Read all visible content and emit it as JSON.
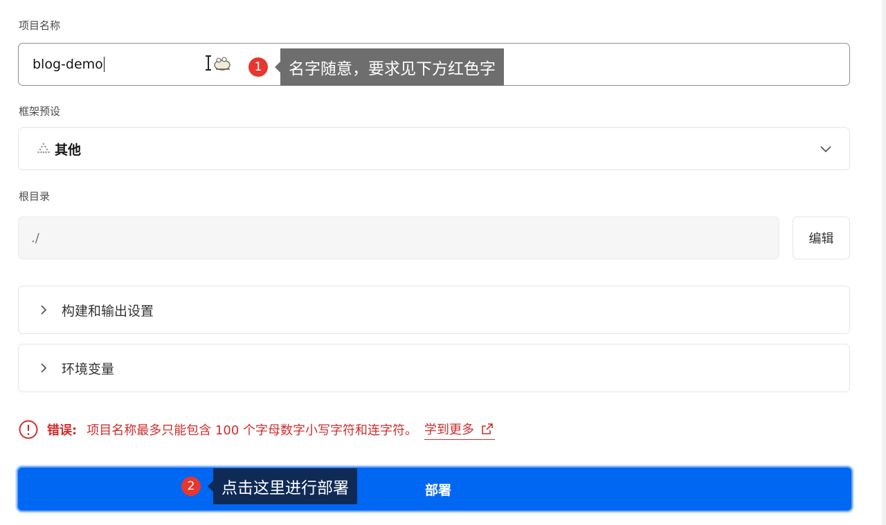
{
  "project_name": {
    "label": "项目名称",
    "value": "blog-demo"
  },
  "framework": {
    "label": "框架预设",
    "value": "其他",
    "icon": "triangle-dots-icon"
  },
  "root_dir": {
    "label": "根目录",
    "value": "./",
    "edit_label": "编辑"
  },
  "sections": {
    "build": "构建和输出设置",
    "env": "环境变量"
  },
  "error": {
    "label": "错误:",
    "message": "项目名称最多只能包含 100 个字母数字小写字符和连字符。",
    "link": "学到更多"
  },
  "deploy": {
    "label": "部署"
  },
  "tooltips": {
    "t1": {
      "number": "1",
      "text": "名字随意，要求见下方红色字"
    },
    "t2": {
      "number": "2",
      "text": "点击这里进行部署"
    }
  },
  "colors": {
    "accent": "#0067f2",
    "error": "#d12c2c",
    "badge": "#e7372f"
  }
}
